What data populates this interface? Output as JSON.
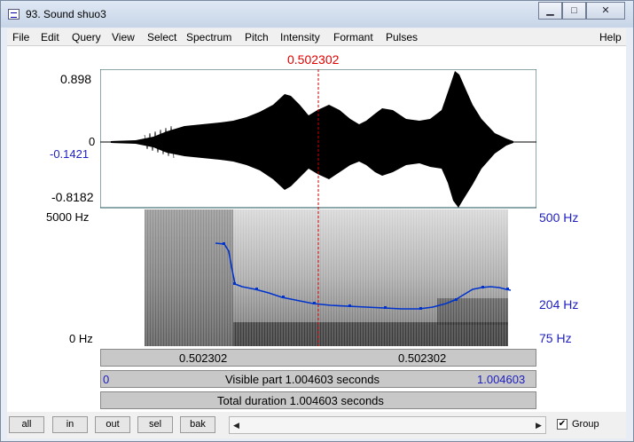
{
  "window": {
    "title": "93. Sound shuo3"
  },
  "window_controls": {
    "minimize": "▁",
    "maximize": "□",
    "close": "✕"
  },
  "menu": [
    "File",
    "Edit",
    "Query",
    "View",
    "Select",
    "Spectrum",
    "Pitch",
    "Intensity",
    "Formant",
    "Pulses"
  ],
  "help_label": "Help",
  "cursor_time": "0.502302",
  "waveform": {
    "ymax": "0.898",
    "zero": "0",
    "cursor_value": "-0.1421",
    "ymin": "-0.8182"
  },
  "spectrogram": {
    "top_freq": "5000 Hz",
    "bottom_freq": "0 Hz"
  },
  "pitch": {
    "top": "500 Hz",
    "current": "204 Hz",
    "bottom": "75 Hz"
  },
  "segment_bar": {
    "left": "0.502302",
    "right": "0.502302"
  },
  "visible_bar": {
    "start": "0",
    "label": "Visible part 1.004603 seconds",
    "end": "1.004603"
  },
  "total_bar": {
    "label": "Total duration 1.004603 seconds"
  },
  "buttons": {
    "all": "all",
    "in": "in",
    "out": "out",
    "sel": "sel",
    "bak": "bak"
  },
  "group": {
    "label": "Group",
    "checked": true
  },
  "colors": {
    "cursor": "#cc0000",
    "pitch": "#0033cc",
    "window_frame": "#c7d5e8"
  }
}
